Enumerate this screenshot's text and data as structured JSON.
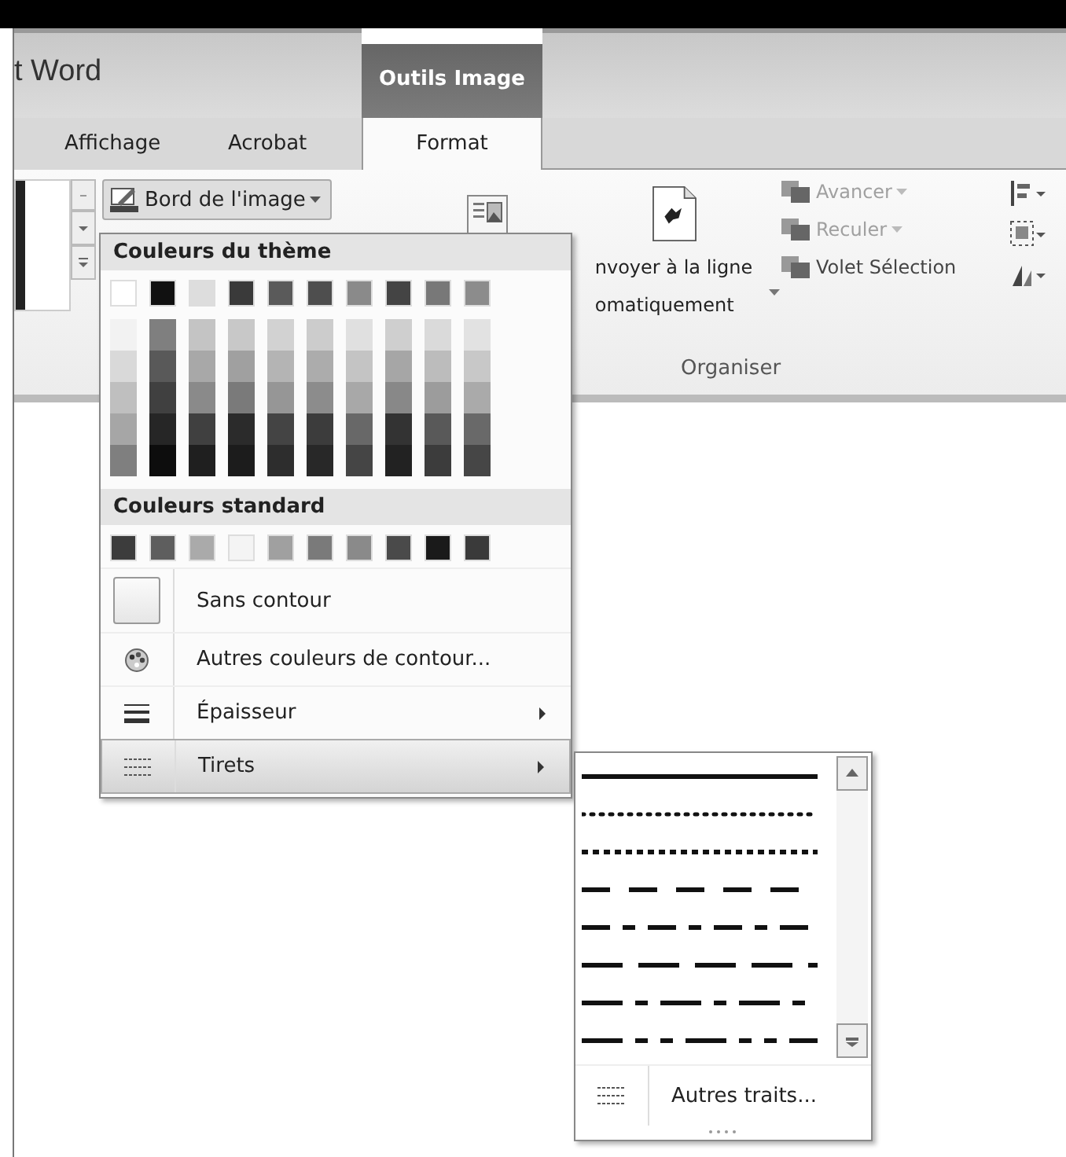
{
  "window": {
    "title": "t Word"
  },
  "context_tab": {
    "label": "Outils Image"
  },
  "tabs": [
    {
      "label": "Affichage",
      "selected": false
    },
    {
      "label": "Acrobat",
      "selected": false
    },
    {
      "label": "Format",
      "selected": true
    }
  ],
  "ribbon": {
    "border_button": {
      "label": "Bord de l'image"
    },
    "wrap_button": {
      "label_lines": [
        "nvoyer à la ligne",
        "omatiquement"
      ]
    },
    "arrange_buttons": [
      {
        "label": "Avancer",
        "disabled": true
      },
      {
        "label": "Reculer",
        "disabled": true
      },
      {
        "label": "Volet Sélection",
        "disabled": false
      }
    ],
    "group_label": "Organiser"
  },
  "outline_menu": {
    "theme_header": "Couleurs du thème",
    "theme_colors": [
      {
        "color": "#ffffff",
        "shades": [
          {
            "color": "#f2f2f2"
          },
          {
            "color": "#d9d9d9"
          },
          {
            "color": "#bfbfbf"
          },
          {
            "color": "#a6a6a6"
          },
          {
            "color": "#7f7f7f"
          }
        ]
      },
      {
        "color": "#111111",
        "shades": [
          {
            "color": "#7f7f7f"
          },
          {
            "color": "#595959"
          },
          {
            "color": "#404040"
          },
          {
            "color": "#262626"
          },
          {
            "color": "#0d0d0d"
          }
        ]
      },
      {
        "color": "#dddddd",
        "shades": [
          {
            "color": "#c4c4c4"
          },
          {
            "color": "#a8a8a8"
          },
          {
            "color": "#8a8a8a"
          },
          {
            "color": "#404040"
          },
          {
            "color": "#1f1f1f"
          }
        ]
      },
      {
        "color": "#3a3a3a",
        "shades": [
          {
            "color": "#c8c8c8"
          },
          {
            "color": "#a0a0a0"
          },
          {
            "color": "#7a7a7a"
          },
          {
            "color": "#2b2b2b"
          },
          {
            "color": "#1c1c1c"
          }
        ]
      },
      {
        "color": "#5a5a5a",
        "shades": [
          {
            "color": "#d2d2d2"
          },
          {
            "color": "#b4b4b4"
          },
          {
            "color": "#969696"
          },
          {
            "color": "#444444"
          },
          {
            "color": "#2d2d2d"
          }
        ]
      },
      {
        "color": "#4e4e4e",
        "shades": [
          {
            "color": "#cccccc"
          },
          {
            "color": "#acacac"
          },
          {
            "color": "#8c8c8c"
          },
          {
            "color": "#3c3c3c"
          },
          {
            "color": "#282828"
          }
        ]
      },
      {
        "color": "#8a8a8a",
        "shades": [
          {
            "color": "#e0e0e0"
          },
          {
            "color": "#c4c4c4"
          },
          {
            "color": "#a8a8a8"
          },
          {
            "color": "#686868"
          },
          {
            "color": "#454545"
          }
        ]
      },
      {
        "color": "#444444",
        "shades": [
          {
            "color": "#cfcfcf"
          },
          {
            "color": "#a6a6a6"
          },
          {
            "color": "#888888"
          },
          {
            "color": "#333333"
          },
          {
            "color": "#222222"
          }
        ]
      },
      {
        "color": "#787878",
        "shades": [
          {
            "color": "#dadada"
          },
          {
            "color": "#bcbcbc"
          },
          {
            "color": "#9c9c9c"
          },
          {
            "color": "#595959"
          },
          {
            "color": "#3c3c3c"
          }
        ]
      },
      {
        "color": "#8c8c8c",
        "shades": [
          {
            "color": "#e2e2e2"
          },
          {
            "color": "#c8c8c8"
          },
          {
            "color": "#aaaaaa"
          },
          {
            "color": "#696969"
          },
          {
            "color": "#464646"
          }
        ]
      }
    ],
    "standard_header": "Couleurs standard",
    "standard_colors": [
      {
        "color": "#3c3c3c"
      },
      {
        "color": "#5e5e5e"
      },
      {
        "color": "#aaaaaa"
      },
      {
        "color": "#f4f4f4"
      },
      {
        "color": "#a0a0a0"
      },
      {
        "color": "#7a7a7a"
      },
      {
        "color": "#8a8a8a"
      },
      {
        "color": "#4a4a4a"
      },
      {
        "color": "#1a1a1a"
      },
      {
        "color": "#3a3a3a"
      }
    ],
    "items": [
      {
        "kind": "no-outline",
        "label": "Sans contour",
        "selected": false,
        "submenu": false
      },
      {
        "kind": "more-colors",
        "label": "Autres couleurs de contour...",
        "selected": false,
        "submenu": false
      },
      {
        "kind": "weight",
        "label": "Épaisseur",
        "selected": false,
        "submenu": true
      },
      {
        "kind": "dashes",
        "label": "Tirets",
        "selected": true,
        "submenu": true
      }
    ]
  },
  "dash_menu": {
    "styles": [
      {
        "kind": "solid"
      },
      {
        "kind": "round-dot"
      },
      {
        "kind": "square-dot"
      },
      {
        "kind": "dash"
      },
      {
        "kind": "dash-dot"
      },
      {
        "kind": "long-dash"
      },
      {
        "kind": "long-dash-dot"
      },
      {
        "kind": "long-dash-dot-dot"
      }
    ],
    "more_label": "Autres traits..."
  }
}
